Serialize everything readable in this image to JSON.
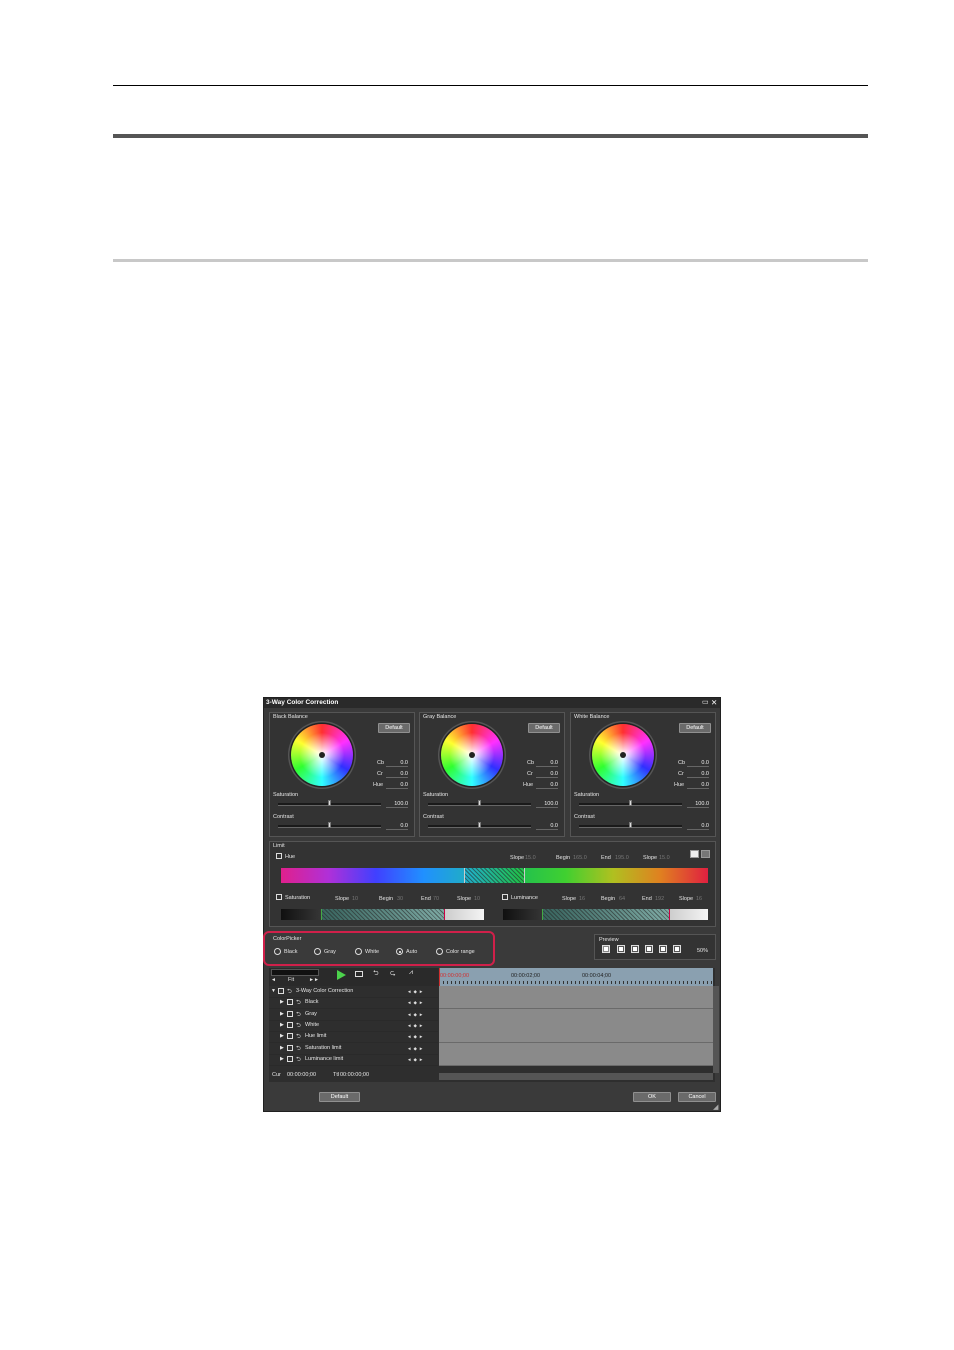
{
  "window": {
    "title": "3-Way Color Correction",
    "controls": {
      "restore_icon": "restore-icon",
      "close_icon": "close-icon",
      "close_glyph": "✕",
      "restore_glyph": "▭"
    }
  },
  "balance": [
    {
      "title": "Black Balance",
      "default_label": "Default",
      "cb_label": "Cb",
      "cb": "0.0",
      "cr_label": "Cr",
      "cr": "0.0",
      "hue_label": "Hue",
      "hue": "0.0",
      "saturation_label": "Saturation",
      "saturation": "100.0",
      "contrast_label": "Contrast",
      "contrast": "0.0"
    },
    {
      "title": "Gray Balance",
      "default_label": "Default",
      "cb_label": "Cb",
      "cb": "0.0",
      "cr_label": "Cr",
      "cr": "0.0",
      "hue_label": "Hue",
      "hue": "0.0",
      "saturation_label": "Saturation",
      "saturation": "100.0",
      "contrast_label": "Contrast",
      "contrast": "0.0"
    },
    {
      "title": "White Balance",
      "default_label": "Default",
      "cb_label": "Cb",
      "cb": "0.0",
      "cr_label": "Cr",
      "cr": "0.0",
      "hue_label": "Hue",
      "hue": "0.0",
      "saturation_label": "Saturation",
      "saturation": "100.0",
      "contrast_label": "Contrast",
      "contrast": "0.0"
    }
  ],
  "limit": {
    "title": "Limit",
    "hue": {
      "label": "Hue",
      "slope_label": "Slope",
      "slope": "15.0",
      "begin_label": "Begin",
      "begin": "165.0",
      "end_label": "End",
      "end": "195.0",
      "slope2_label": "Slope",
      "slope2": "15.0"
    },
    "saturation": {
      "label": "Saturation",
      "slope_label": "Slope",
      "slope": "10",
      "begin_label": "Begin",
      "begin": "30",
      "end_label": "End",
      "end": "70",
      "slope2_label": "Slope",
      "slope2": "10"
    },
    "luminance": {
      "label": "Luminance",
      "slope_label": "Slope",
      "slope": "16",
      "begin_label": "Begin",
      "begin": "64",
      "end_label": "End",
      "end": "192",
      "slope2_label": "Slope",
      "slope2": "16"
    }
  },
  "colorpicker": {
    "title": "ColorPicker",
    "options": [
      "Black",
      "Gray",
      "White",
      "Auto",
      "Color range"
    ],
    "selected": "Auto"
  },
  "preview": {
    "title": "Preview",
    "zoom": "50%"
  },
  "timeline": {
    "fit_label": "Fit",
    "timecodes": [
      "00:00:00;00",
      "00:00:02;00",
      "00:00:04;00"
    ],
    "tracks": [
      {
        "label": "3-Way Color Correction"
      },
      {
        "label": "Black"
      },
      {
        "label": "Gray"
      },
      {
        "label": "White"
      },
      {
        "label": "Hue limit"
      },
      {
        "label": "Saturation limit"
      },
      {
        "label": "Luminance limit"
      }
    ],
    "cur_label": "Cur",
    "cur": "00:00:00;00",
    "ttl_label": "Ttl",
    "ttl": "00:00:00;00"
  },
  "footer": {
    "default_label": "Default",
    "ok_label": "OK",
    "cancel_label": "Cancel"
  },
  "colors": {
    "highlight": "#d0204a",
    "playhead": "#d03030",
    "play_icon": "#4cd34c"
  }
}
